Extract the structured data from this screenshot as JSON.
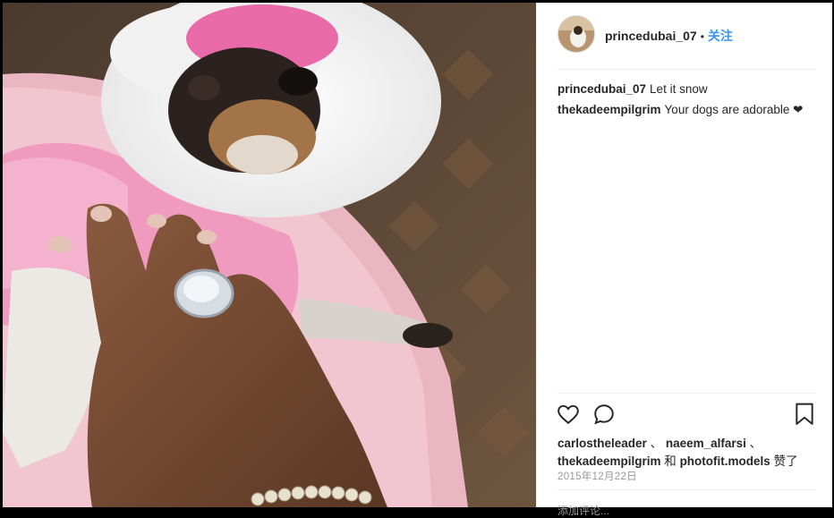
{
  "post": {
    "username": "princedubai_07",
    "separator": "•",
    "follow_label": "关注"
  },
  "comments": [
    {
      "user": "princedubai_07",
      "text": "Let it snow"
    },
    {
      "user": "thekadeempilgrim",
      "text": "Your dogs are adorable ❤"
    }
  ],
  "likes": {
    "users": [
      "carlostheleader",
      "naeem_alfarsi",
      "thekadeempilgrim",
      "photofit.models"
    ],
    "sep1": " 、 ",
    "sep2": " 、",
    "and": " 和 ",
    "suffix": " 赞了"
  },
  "date": "2015年12月22日",
  "add_comment_placeholder": "添加评论..."
}
